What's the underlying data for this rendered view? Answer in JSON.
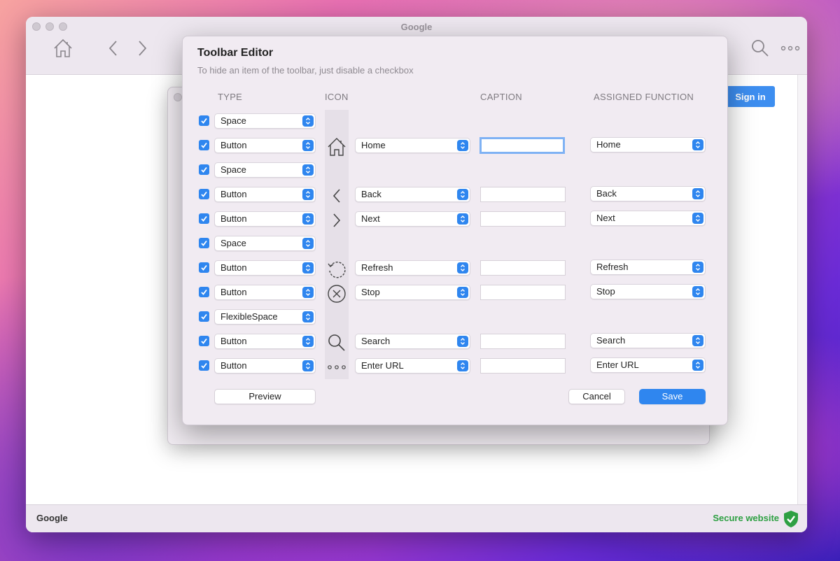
{
  "window": {
    "title": "Google",
    "signin_label": "Sign in",
    "status_left": "Google",
    "status_right": "Secure website"
  },
  "dialog": {
    "title": "Toolbar Editor",
    "subtitle": "To hide an item of the toolbar, just disable a checkbox",
    "headers": {
      "type": "TYPE",
      "icon": "ICON",
      "caption": "CAPTION",
      "function": "ASSIGNED FUNCTION"
    },
    "rows": [
      {
        "checked": true,
        "type": "Space"
      },
      {
        "checked": true,
        "type": "Button",
        "icon": "home-icon",
        "item": "Home",
        "caption": "",
        "function": "Home"
      },
      {
        "checked": true,
        "type": "Space"
      },
      {
        "checked": true,
        "type": "Button",
        "icon": "chevron-left-icon",
        "item": "Back",
        "caption": "",
        "function": "Back"
      },
      {
        "checked": true,
        "type": "Button",
        "icon": "chevron-right-icon",
        "item": "Next",
        "caption": "",
        "function": "Next"
      },
      {
        "checked": true,
        "type": "Space"
      },
      {
        "checked": true,
        "type": "Button",
        "icon": "refresh-icon",
        "item": "Refresh",
        "caption": "",
        "function": "Refresh"
      },
      {
        "checked": true,
        "type": "Button",
        "icon": "stop-icon",
        "item": "Stop",
        "caption": "",
        "function": "Stop"
      },
      {
        "checked": true,
        "type": "FlexibleSpace"
      },
      {
        "checked": true,
        "type": "Button",
        "icon": "search-icon",
        "item": "Search",
        "caption": "",
        "function": "Search"
      },
      {
        "checked": true,
        "type": "Button",
        "icon": "more-dots-icon",
        "item": "Enter URL",
        "caption": "",
        "function": "Enter URL"
      }
    ],
    "preview_label": "Preview",
    "cancel_label": "Cancel",
    "save_label": "Save"
  }
}
